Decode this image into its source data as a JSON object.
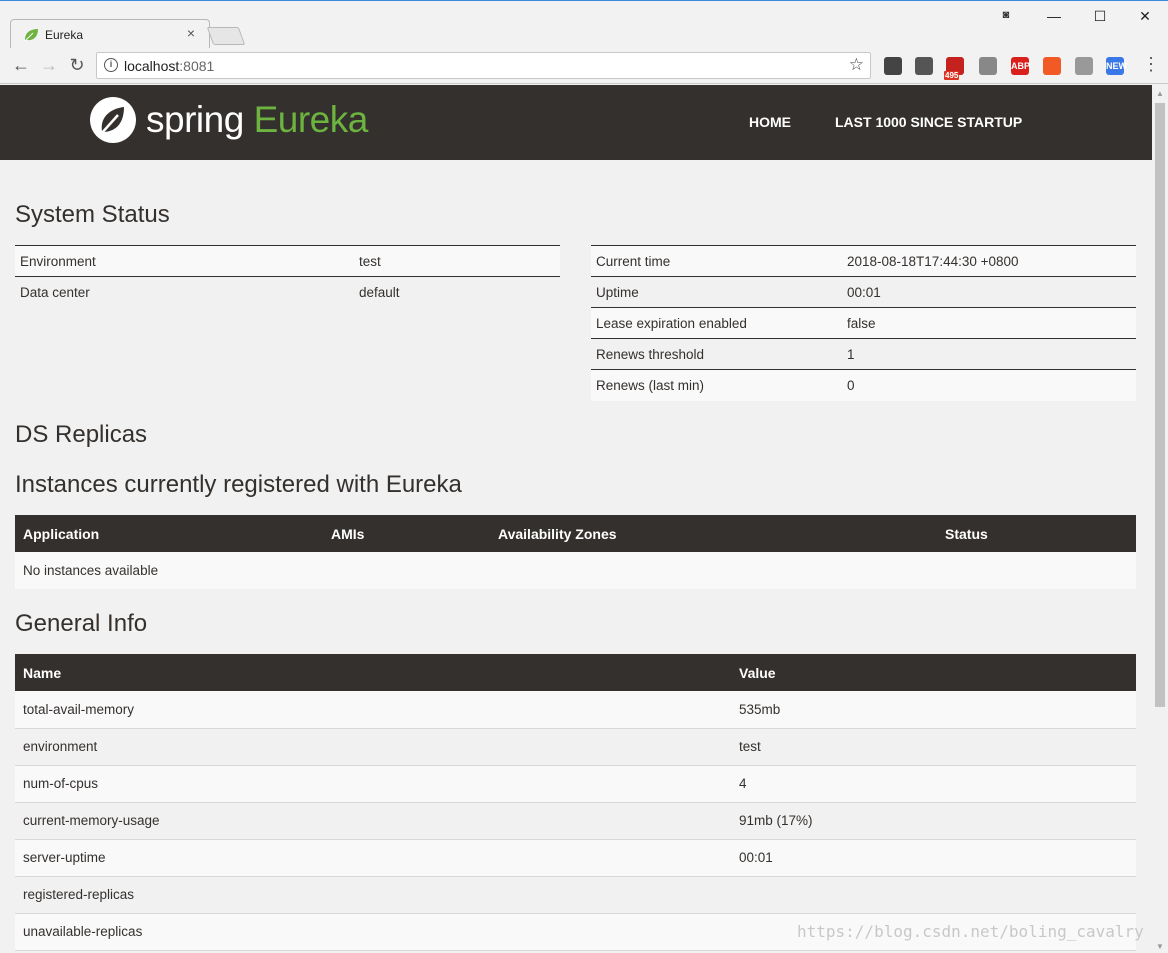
{
  "browser": {
    "tab_title": "Eureka",
    "url_host": "localhost",
    "url_port": ":8081",
    "extensions": [
      {
        "name": "qr-code-icon",
        "color": "#444"
      },
      {
        "name": "evernote-icon",
        "color": "#555"
      },
      {
        "name": "gmail-icon",
        "color": "#c5221f",
        "badge": "495"
      },
      {
        "name": "shield-extension-icon",
        "color": "#888"
      },
      {
        "name": "adblock-plus-icon",
        "color": "#d9201c",
        "label": "ABP"
      },
      {
        "name": "infinity-icon",
        "color": "#f15a24"
      },
      {
        "name": "extension-warning-icon",
        "color": "#999"
      },
      {
        "name": "new-extension-icon",
        "color": "#3b78e7",
        "label": "NEW"
      }
    ]
  },
  "navbar": {
    "logo_spring": "spring",
    "logo_eureka": "Eureka",
    "links": [
      "HOME",
      "LAST 1000 SINCE STARTUP"
    ]
  },
  "system_status": {
    "title": "System Status",
    "left": [
      {
        "key": "Environment",
        "value": "test"
      },
      {
        "key": "Data center",
        "value": "default"
      }
    ],
    "right": [
      {
        "key": "Current time",
        "value": "2018-08-18T17:44:30 +0800"
      },
      {
        "key": "Uptime",
        "value": "00:01"
      },
      {
        "key": "Lease expiration enabled",
        "value": "false"
      },
      {
        "key": "Renews threshold",
        "value": "1"
      },
      {
        "key": "Renews (last min)",
        "value": "0"
      }
    ]
  },
  "ds_replicas": {
    "title": "DS Replicas"
  },
  "instances": {
    "title": "Instances currently registered with Eureka",
    "columns": [
      "Application",
      "AMIs",
      "Availability Zones",
      "Status"
    ],
    "empty_message": "No instances available"
  },
  "general_info": {
    "title": "General Info",
    "columns": [
      "Name",
      "Value"
    ],
    "rows": [
      {
        "name": "total-avail-memory",
        "value": "535mb"
      },
      {
        "name": "environment",
        "value": "test"
      },
      {
        "name": "num-of-cpus",
        "value": "4"
      },
      {
        "name": "current-memory-usage",
        "value": "91mb (17%)"
      },
      {
        "name": "server-uptime",
        "value": "00:01"
      },
      {
        "name": "registered-replicas",
        "value": ""
      },
      {
        "name": "unavailable-replicas",
        "value": ""
      }
    ]
  },
  "watermark": "https://blog.csdn.net/boling_cavalry"
}
